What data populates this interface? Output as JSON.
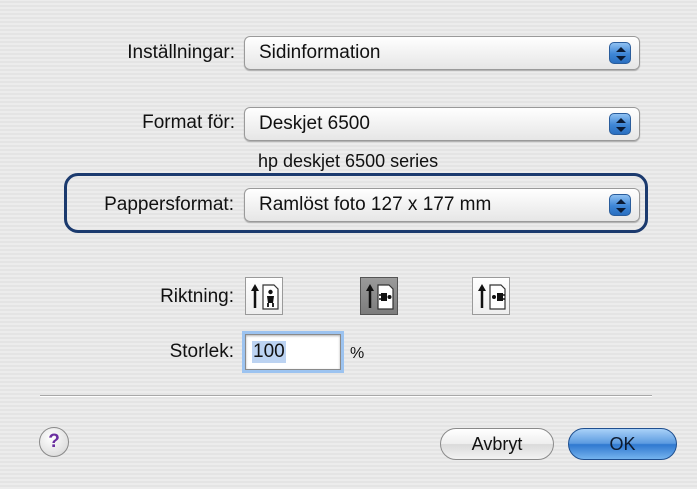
{
  "settings": {
    "label": "Inställningar:",
    "value": "Sidinformation"
  },
  "format_for": {
    "label": "Format för:",
    "value": "Deskjet 6500",
    "printer_description": "hp deskjet 6500 series"
  },
  "paper_size": {
    "label": "Pappersformat:",
    "value": "Ramlöst foto 127 x 177 mm"
  },
  "orientation": {
    "label": "Riktning:",
    "options": [
      "portrait",
      "landscape-left",
      "landscape-right"
    ],
    "selected": "landscape-left"
  },
  "scale": {
    "label": "Storlek:",
    "value": "100",
    "unit": "%"
  },
  "buttons": {
    "help": "?",
    "cancel": "Avbryt",
    "ok": "OK"
  },
  "colors": {
    "accent": "#3e86d6",
    "highlight_border": "#1b3a6e",
    "help_glyph": "#6a2fa0"
  }
}
